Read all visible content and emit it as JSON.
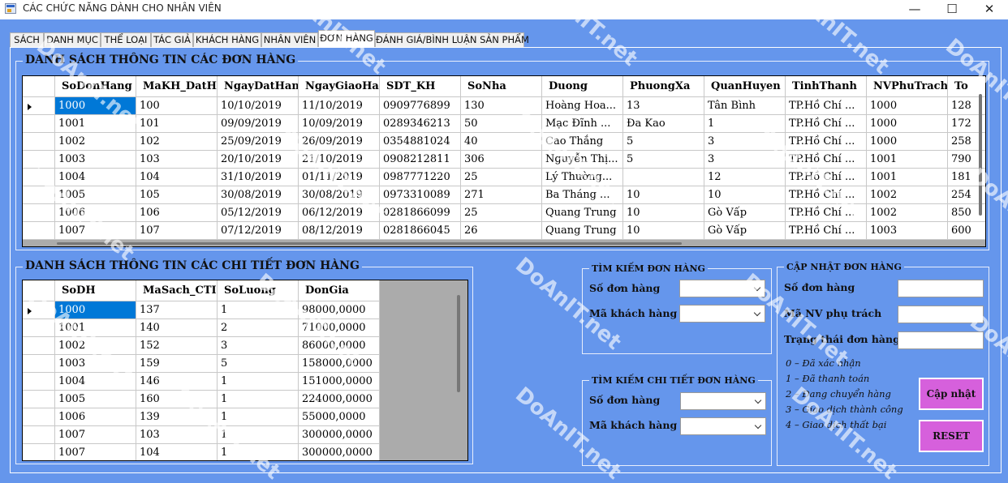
{
  "window": {
    "title": "CÁC CHỨC NĂNG DÀNH CHO NHÂN VIÊN",
    "minimize": "—",
    "maximize": "☐",
    "close": "✕"
  },
  "tabs": [
    {
      "label": "SÁCH",
      "active": false
    },
    {
      "label": "DANH MỤC",
      "active": false
    },
    {
      "label": "THỂ LOẠI",
      "active": false
    },
    {
      "label": "TÁC GIẢ",
      "active": false
    },
    {
      "label": "KHÁCH HÀNG",
      "active": false
    },
    {
      "label": "NHÂN VIÊN",
      "active": false
    },
    {
      "label": "ĐƠN HÀNG",
      "active": true
    },
    {
      "label": "ĐÁNH GIÁ/BÌNH LUẬN SẢN PHẨM",
      "active": false
    }
  ],
  "orders": {
    "title": "DANH SÁCH THÔNG TIN CÁC ĐƠN HÀNG",
    "columns": [
      "SoDonHang",
      "MaKH_DatH",
      "NgayDatHan",
      "NgayGiaoHa",
      "SDT_KH",
      "SoNha",
      "Duong",
      "PhuongXa",
      "QuanHuyen",
      "TinhThanh",
      "NVPhuTrach",
      "To"
    ],
    "rows": [
      [
        "1000",
        "100",
        "10/10/2019",
        "11/10/2019",
        "0909776899",
        "130",
        "Hoàng Hoa...",
        "13",
        "Tân Bình",
        "TP.Hồ Chí ...",
        "1000",
        "128"
      ],
      [
        "1001",
        "101",
        "09/09/2019",
        "10/09/2019",
        "0289346213",
        "50",
        "Mạc Đĩnh ...",
        "Đa Kao",
        "1",
        "TP.Hồ Chí ...",
        "1000",
        "172"
      ],
      [
        "1002",
        "102",
        "25/09/2019",
        "26/09/2019",
        "0354881024",
        "40",
        "Cao Thắng",
        "5",
        "3",
        "TP.Hồ Chí ...",
        "1000",
        "258"
      ],
      [
        "1003",
        "103",
        "20/10/2019",
        "21/10/2019",
        "0908212811",
        "306",
        "Nguyễn Thị...",
        "5",
        "3",
        "TP.Hồ Chí ...",
        "1001",
        "790"
      ],
      [
        "1004",
        "104",
        "31/10/2019",
        "01/11/2019",
        "0987771220",
        "25",
        "Lý Thường...",
        "",
        "12",
        "TP.Hồ Chí ...",
        "1001",
        "181"
      ],
      [
        "1005",
        "105",
        "30/08/2019",
        "30/08/2019",
        "0973310089",
        "271",
        "Ba Tháng ...",
        "10",
        "10",
        "TP.Hồ Chí ...",
        "1002",
        "254"
      ],
      [
        "1006",
        "106",
        "05/12/2019",
        "06/12/2019",
        "0281866099",
        "25",
        "Quang Trung",
        "10",
        "Gò Vấp",
        "TP.Hồ Chí ...",
        "1002",
        "850"
      ],
      [
        "1007",
        "107",
        "07/12/2019",
        "08/12/2019",
        "0281866045",
        "26",
        "Quang Trung",
        "10",
        "Gò Vấp",
        "TP.Hồ Chí ...",
        "1003",
        "600"
      ]
    ]
  },
  "details": {
    "title": "DANH SÁCH THÔNG TIN CÁC CHI TIẾT ĐƠN HÀNG",
    "columns": [
      "SoDH",
      "MaSach_CTI",
      "SoLuong",
      "DonGia"
    ],
    "rows": [
      [
        "1000",
        "137",
        "1",
        "98000,0000"
      ],
      [
        "1001",
        "140",
        "2",
        "71000,0000"
      ],
      [
        "1002",
        "152",
        "3",
        "86000,0000"
      ],
      [
        "1003",
        "159",
        "5",
        "158000,0000"
      ],
      [
        "1004",
        "146",
        "1",
        "151000,0000"
      ],
      [
        "1005",
        "160",
        "1",
        "224000,0000"
      ],
      [
        "1006",
        "139",
        "1",
        "55000,0000"
      ],
      [
        "1007",
        "103",
        "1",
        "300000,0000"
      ],
      [
        "1007",
        "104",
        "1",
        "300000,0000"
      ]
    ]
  },
  "search_order": {
    "title": "TÌM KIẾM ĐƠN HÀNG",
    "order_label": "Số đơn hàng",
    "customer_label": "Mã khách hàng",
    "order_value": "",
    "customer_value": ""
  },
  "search_detail": {
    "title": "TÌM KIẾM CHI TIẾT ĐƠN HÀNG",
    "order_label": "Số đơn hàng",
    "customer_label": "Mã khách hàng",
    "order_value": "",
    "customer_value": ""
  },
  "update": {
    "title": "CẬP NHẬT ĐƠN HÀNG",
    "order_label": "Số đơn hàng",
    "staff_label": "Mã NV phụ trách",
    "status_label": "Trạng thái đơn hàng",
    "order_value": "",
    "staff_value": "",
    "status_value": "",
    "status_notes": [
      "0 – Đã xác nhận",
      "1 – Đã thanh toán",
      "2 – Đang chuyển hàng",
      "3 – Giao dịch thành công",
      "4 – Giao dịch thất bại"
    ],
    "update_button": "Cập nhật",
    "reset_button": "RESET"
  },
  "watermark": "DoAnIT.net",
  "colors": {
    "background": "#6596ec",
    "selection": "#0078d7",
    "button": "#d660dc"
  }
}
